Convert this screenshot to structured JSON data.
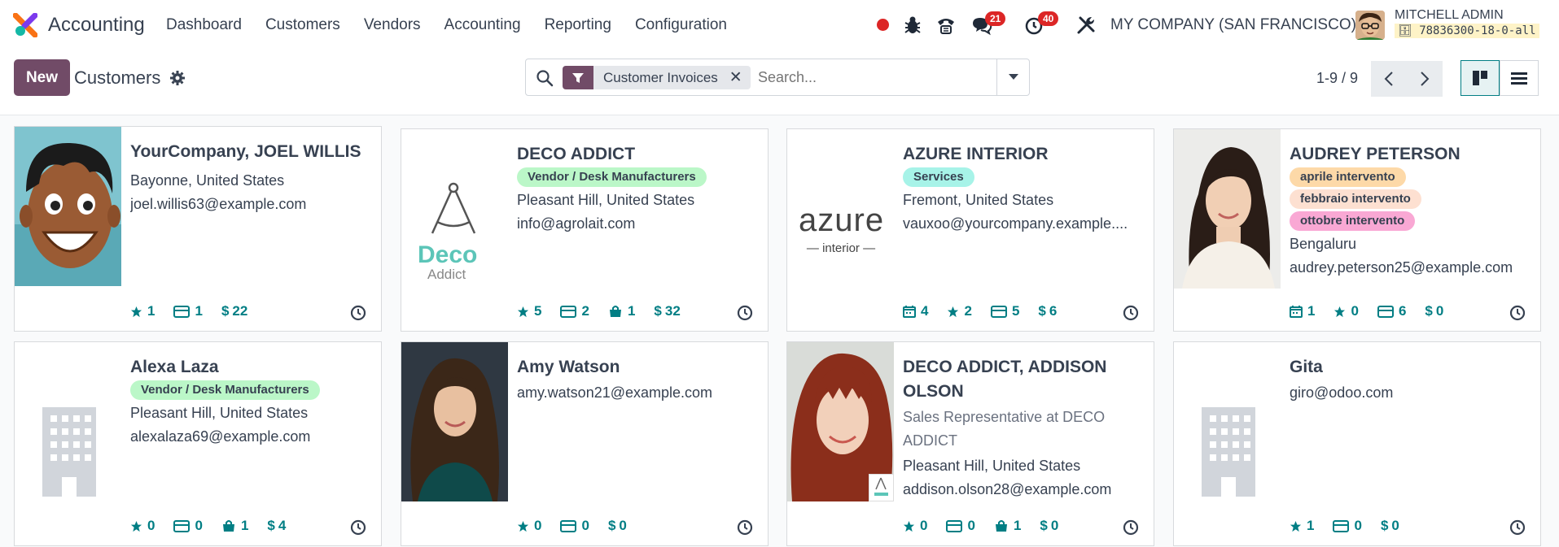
{
  "app": {
    "name": "Accounting"
  },
  "menu": [
    "Dashboard",
    "Customers",
    "Vendors",
    "Accounting",
    "Reporting",
    "Configuration"
  ],
  "systray": {
    "messages_count": "21",
    "activities_count": "40",
    "company": "MY COMPANY (SAN FRANCISCO)",
    "user": "MITCHELL ADMIN",
    "db": "78836300-18-0-all"
  },
  "control": {
    "new_label": "New",
    "title": "Customers",
    "facet": "Customer Invoices",
    "search_placeholder": "Search...",
    "pager": "1-9 / 9"
  },
  "colors": {
    "brand": "#714b67",
    "stat": "#017e84",
    "tag_green": "#bbf7c8",
    "tag_orange": "#fdd9a8",
    "tag_peach": "#fde0d1",
    "tag_pink": "#f9a8d4",
    "tag_teal": "#a7f3e8"
  },
  "cards": [
    {
      "name": "YourCompany, JOEL WILLIS",
      "lines": [
        "Bayonne, United States",
        "joel.willis63@example.com"
      ],
      "stats": [
        [
          "star",
          "1"
        ],
        [
          "card",
          "1"
        ],
        [
          "dollar",
          "22"
        ]
      ]
    },
    {
      "name": "DECO ADDICT",
      "tags": [
        [
          "Vendor / Desk Manufacturers",
          "green"
        ]
      ],
      "lines": [
        "Pleasant Hill, United States",
        "info@agrolait.com"
      ],
      "stats": [
        [
          "star",
          "5"
        ],
        [
          "card",
          "2"
        ],
        [
          "bag",
          "1"
        ],
        [
          "dollar",
          "32"
        ]
      ]
    },
    {
      "name": "AZURE INTERIOR",
      "tags": [
        [
          "Services",
          "teal"
        ]
      ],
      "lines": [
        "Fremont, United States",
        "vauxoo@yourcompany.example...."
      ],
      "stats": [
        [
          "cal",
          "4"
        ],
        [
          "star",
          "2"
        ],
        [
          "card",
          "5"
        ],
        [
          "dollar",
          "6"
        ]
      ]
    },
    {
      "name": "AUDREY PETERSON",
      "tags": [
        [
          "aprile intervento",
          "orange"
        ],
        [
          "febbraio intervento",
          "peach"
        ],
        [
          "ottobre intervento",
          "pink"
        ]
      ],
      "lines": [
        "Bengaluru",
        "audrey.peterson25@example.com"
      ],
      "stats": [
        [
          "cal",
          "1"
        ],
        [
          "star",
          "0"
        ],
        [
          "card",
          "6"
        ],
        [
          "dollar",
          "0"
        ]
      ]
    },
    {
      "name": "Alexa Laza",
      "tags": [
        [
          "Vendor / Desk Manufacturers",
          "green"
        ]
      ],
      "lines": [
        "Pleasant Hill, United States",
        "alexalaza69@example.com"
      ],
      "stats": [
        [
          "star",
          "0"
        ],
        [
          "card",
          "0"
        ],
        [
          "bag",
          "1"
        ],
        [
          "dollar",
          "4"
        ]
      ]
    },
    {
      "name": "Amy Watson",
      "lines": [
        "amy.watson21@example.com"
      ],
      "stats": [
        [
          "star",
          "0"
        ],
        [
          "card",
          "0"
        ],
        [
          "dollar",
          "0"
        ]
      ]
    },
    {
      "name": "DECO ADDICT, ADDISON OLSON",
      "subtitle": "Sales Representative at DECO ADDICT",
      "lines": [
        "Pleasant Hill, United States",
        "addison.olson28@example.com"
      ],
      "stats": [
        [
          "star",
          "0"
        ],
        [
          "card",
          "0"
        ],
        [
          "bag",
          "1"
        ],
        [
          "dollar",
          "0"
        ]
      ]
    },
    {
      "name": "Gita",
      "lines": [
        "giro@odoo.com"
      ],
      "stats": [
        [
          "star",
          "1"
        ],
        [
          "card",
          "0"
        ],
        [
          "dollar",
          "0"
        ]
      ]
    }
  ],
  "logos": {
    "deco_line1": "Deco",
    "deco_line2": "Addict",
    "azure_line1": "azure",
    "azure_line2": "interior"
  }
}
